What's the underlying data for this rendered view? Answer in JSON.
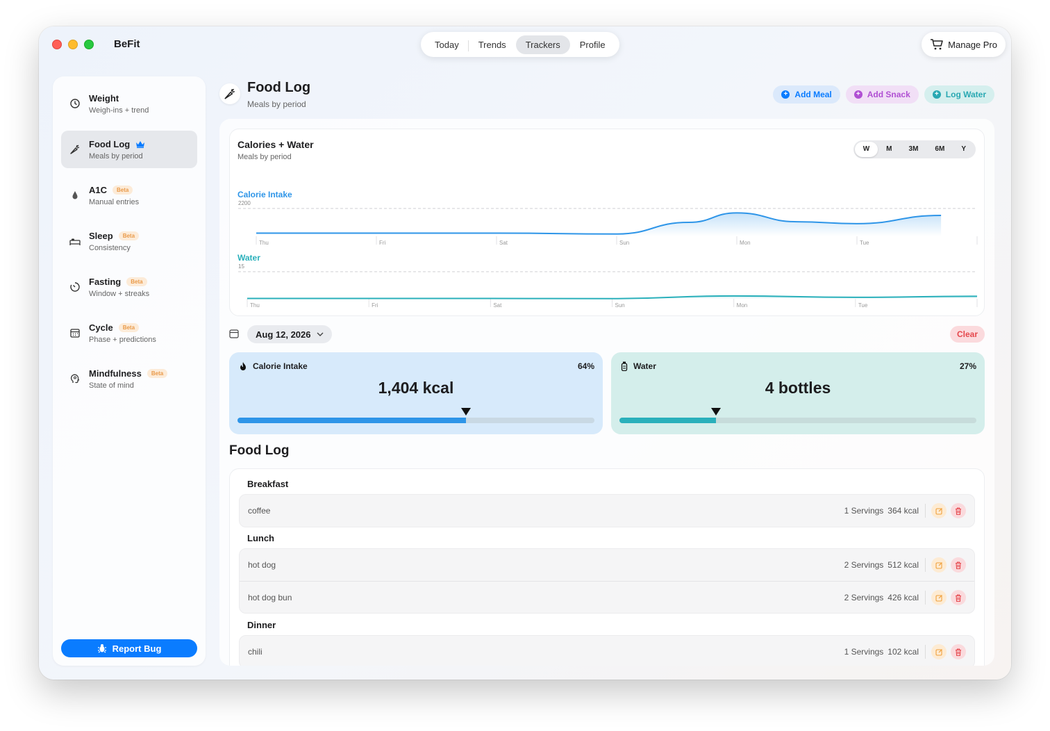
{
  "app": {
    "title": "BeFit"
  },
  "nav": {
    "tabs": [
      {
        "label": "Today"
      },
      {
        "label": "Trends"
      },
      {
        "label": "Trackers"
      },
      {
        "label": "Profile"
      }
    ],
    "active": "Trackers"
  },
  "manage_pro": {
    "label": "Manage Pro"
  },
  "sidebar": {
    "items": [
      {
        "title": "Weight",
        "subtitle": "Weigh-ins + trend",
        "icon": "clock-icon"
      },
      {
        "title": "Food Log",
        "subtitle": "Meals by period",
        "icon": "carrot-icon",
        "badge_icon": "crown-icon",
        "active": true
      },
      {
        "title": "A1C",
        "subtitle": "Manual entries",
        "icon": "drop-icon",
        "badge": "Beta"
      },
      {
        "title": "Sleep",
        "subtitle": "Consistency",
        "icon": "bed-icon",
        "badge": "Beta"
      },
      {
        "title": "Fasting",
        "subtitle": "Window + streaks",
        "icon": "timer-icon",
        "badge": "Beta"
      },
      {
        "title": "Cycle",
        "subtitle": "Phase + predictions",
        "icon": "calendar-icon",
        "badge": "Beta"
      },
      {
        "title": "Mindfulness",
        "subtitle": "State of mind",
        "icon": "head-icon",
        "badge": "Beta"
      }
    ],
    "report_bug": "Report Bug"
  },
  "header": {
    "title": "Food Log",
    "subtitle": "Meals by period"
  },
  "actions": {
    "add_meal": "Add Meal",
    "add_snack": "Add Snack",
    "log_water": "Log Water"
  },
  "chart_card": {
    "title": "Calories + Water",
    "subtitle": "Meals by period",
    "ranges": [
      "W",
      "M",
      "3M",
      "6M",
      "Y"
    ],
    "active_range": "W"
  },
  "chart_data": [
    {
      "type": "area",
      "title": "Calorie Intake",
      "categories": [
        "Thu",
        "Fri",
        "Sat",
        "Sun",
        "Mon",
        "Tue"
      ],
      "x": [
        0,
        1,
        2,
        3,
        3.6,
        4,
        4.5,
        5,
        5.7
      ],
      "y": [
        250,
        250,
        250,
        180,
        1100,
        1850,
        1150,
        1000,
        1650
      ],
      "ylim": [
        0,
        2200
      ],
      "yticks": [
        2200
      ],
      "color": "#2e95e8",
      "grid": true
    },
    {
      "type": "area",
      "title": "Water",
      "categories": [
        "Thu",
        "Fri",
        "Sat",
        "Sun",
        "Mon",
        "Tue"
      ],
      "x": [
        0,
        1,
        2,
        3,
        4,
        5,
        6
      ],
      "y": [
        0.2,
        0.2,
        0.2,
        0.1,
        1.6,
        0.8,
        1.4
      ],
      "ylim": [
        0,
        15
      ],
      "yticks": [
        15
      ],
      "color": "#2ab0bb",
      "grid": true
    }
  ],
  "date_picker": {
    "value": "Aug 12, 2026"
  },
  "clear_label": "Clear",
  "metrics": {
    "calories": {
      "label": "Calorie Intake",
      "percent_label": "64%",
      "value": "1,404 kcal",
      "fill": 0.64
    },
    "water": {
      "label": "Water",
      "percent_label": "27%",
      "value": "4 bottles",
      "fill": 0.27
    }
  },
  "food_log": {
    "title": "Food Log",
    "meals": [
      {
        "name": "Breakfast",
        "entries": [
          {
            "food": "coffee",
            "servings": "1 Servings",
            "kcal": "364 kcal"
          }
        ]
      },
      {
        "name": "Lunch",
        "entries": [
          {
            "food": "hot dog",
            "servings": "2 Servings",
            "kcal": "512 kcal"
          },
          {
            "food": "hot dog bun",
            "servings": "2 Servings",
            "kcal": "426 kcal"
          }
        ]
      },
      {
        "name": "Dinner",
        "entries": [
          {
            "food": "chili",
            "servings": "1 Servings",
            "kcal": "102 kcal"
          }
        ]
      }
    ]
  },
  "colors": {
    "accent": "#0a7cff",
    "calories": "#2e95e8",
    "water": "#2ab0bb",
    "snack": "#b04fd3",
    "danger": "#e5484d",
    "beta": "#e99a4a"
  }
}
